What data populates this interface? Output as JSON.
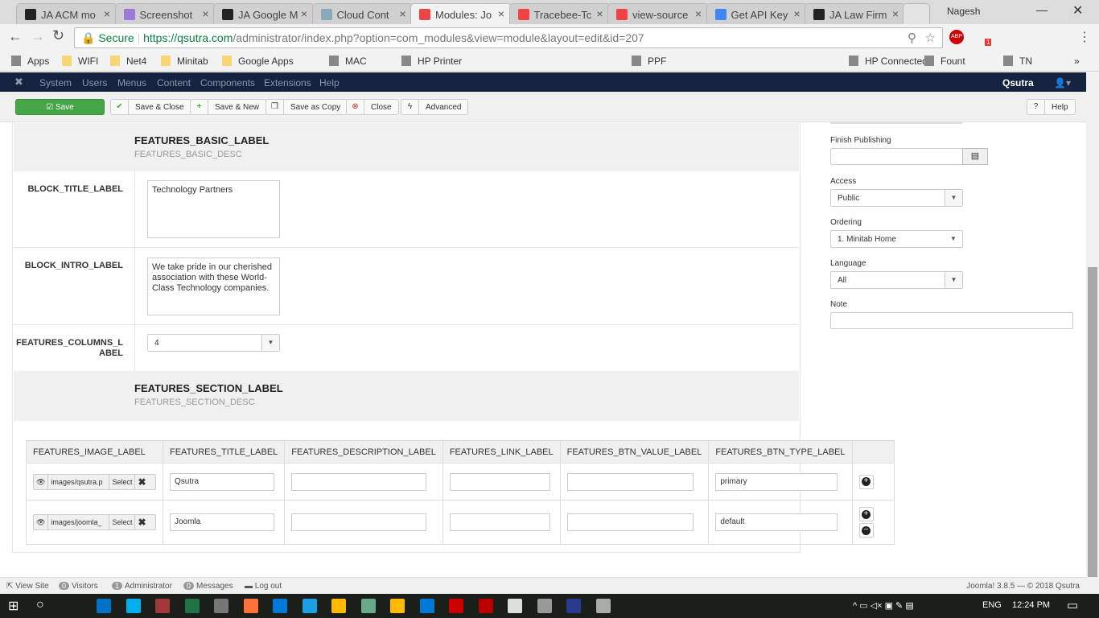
{
  "browser": {
    "tabs": [
      {
        "title": "JA ACM mo",
        "color": "#222"
      },
      {
        "title": "Screenshot",
        "color": "#9b7bd4"
      },
      {
        "title": "JA Google M",
        "color": "#222"
      },
      {
        "title": "Cloud Cont",
        "color": "#8ab"
      },
      {
        "title": "Modules: Jo",
        "color": "#e44"
      },
      {
        "title": "Tracebee-Tc",
        "color": "#e44"
      },
      {
        "title": "view-source",
        "color": "#e44"
      },
      {
        "title": "Get API Key",
        "color": "#4285f4"
      },
      {
        "title": "JA Law Firm",
        "color": "#222"
      }
    ],
    "profile": "Nagesh",
    "secure_label": "Secure",
    "url_host": "https://qsutra.com",
    "url_path": "/administrator/index.php?option=com_modules&view=module&layout=edit&id=207",
    "extension_badge": "1",
    "bookmarks": [
      "Apps",
      "WIFI",
      "Net4",
      "Minitab",
      "Google Apps",
      "MAC",
      "HP Printer",
      "PPF",
      "HP Connected",
      "Fount",
      "TN"
    ]
  },
  "admin_nav": {
    "items": [
      "System",
      "Users",
      "Menus",
      "Content",
      "Components",
      "Extensions",
      "Help"
    ],
    "user": "Qsutra"
  },
  "toolbar": {
    "save": "Save",
    "save_close": "Save & Close",
    "save_new": "Save & New",
    "save_copy": "Save as Copy",
    "close": "Close",
    "advanced": "Advanced",
    "help": "Help",
    "save_color": "#46a546"
  },
  "form": {
    "basic_header": "FEATURES_BASIC_LABEL",
    "basic_desc": "FEATURES_BASIC_DESC",
    "block_title_label": "BLOCK_TITLE_LABEL",
    "block_title_value": "Technology Partners",
    "block_intro_label": "BLOCK_INTRO_LABEL",
    "block_intro_value": "We take pride in our cherished association with these World-Class Technology companies.",
    "columns_label": "FEATURES_COLUMNS_LABEL",
    "columns_value": "4",
    "section_header": "FEATURES_SECTION_LABEL",
    "section_desc": "FEATURES_SECTION_DESC"
  },
  "table": {
    "headers": [
      "FEATURES_IMAGE_LABEL",
      "FEATURES_TITLE_LABEL",
      "FEATURES_DESCRIPTION_LABEL",
      "FEATURES_LINK_LABEL",
      "FEATURES_BTN_VALUE_LABEL",
      "FEATURES_BTN_TYPE_LABEL"
    ],
    "select_label": "Select",
    "rows": [
      {
        "image": "images/qsutra.p",
        "title": "Qsutra",
        "description": "",
        "link": "",
        "btn_value": "",
        "btn_type": "primary"
      },
      {
        "image": "images/joomla_",
        "title": "Joomla",
        "description": "",
        "link": "",
        "btn_value": "",
        "btn_type": "default"
      }
    ]
  },
  "sidebar": {
    "finish_publishing": "Finish Publishing",
    "access_label": "Access",
    "access_value": "Public",
    "ordering_label": "Ordering",
    "ordering_value": "1. Minitab Home",
    "language_label": "Language",
    "language_value": "All",
    "note_label": "Note"
  },
  "footer": {
    "view_site": "View Site",
    "visitors_count": "0",
    "visitors": "Visitors",
    "admin_count": "1",
    "admin": "Administrator",
    "messages_count": "0",
    "messages": "Messages",
    "logout": "Log out",
    "version": "Joomla! 3.8.5 — © 2018 Qsutra"
  },
  "taskbar": {
    "lang": "ENG",
    "time": "12:24 PM"
  }
}
